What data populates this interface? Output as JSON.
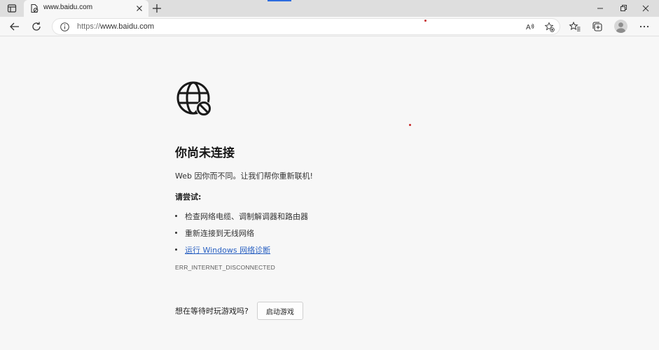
{
  "tab": {
    "title": "www.baidu.com"
  },
  "address": {
    "scheme": "https://",
    "host": "www.baidu.com"
  },
  "error": {
    "heading": "你尚未连接",
    "description": "Web 因你而不同。让我们帮你重新联机!",
    "try_label": "请尝试:",
    "tips": [
      {
        "text": "检查网络电缆、调制解调器和路由器",
        "link": false
      },
      {
        "text": "重新连接到无线网络",
        "link": false
      },
      {
        "text": "运行 Windows 网络诊断",
        "link": true
      }
    ],
    "code": "ERR_INTERNET_DISCONNECTED",
    "game_question": "想在等待时玩游戏吗?",
    "game_button": "启动游戏"
  },
  "icons": {
    "tab_actions": "tab-actions-icon",
    "favicon": "page-favicon-icon",
    "tab_close": "close-icon",
    "new_tab": "plus-icon",
    "back": "back-arrow-icon",
    "refresh": "refresh-icon",
    "info": "info-icon",
    "read_aloud": "read-aloud-icon",
    "add_favorite": "star-add-icon",
    "favorites": "favorites-icon",
    "collections": "collections-icon",
    "profile": "profile-icon",
    "more": "more-icon",
    "error_globe": "globe-blocked-icon"
  },
  "colors": {
    "link": "#2a61c2",
    "accent": "#2d6cdf",
    "page_bg": "#f7f7f7"
  }
}
